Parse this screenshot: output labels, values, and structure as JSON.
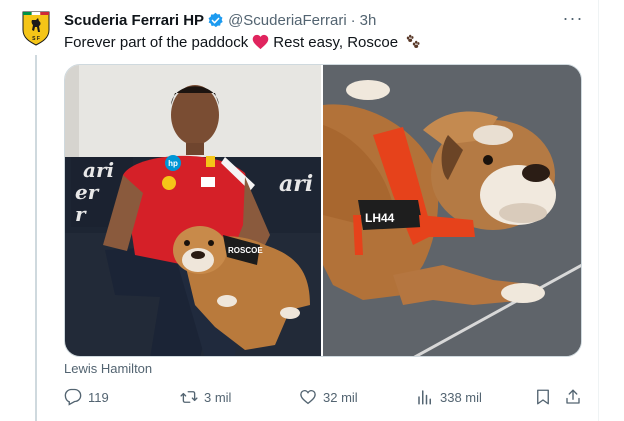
{
  "tweet": {
    "display_name": "Scuderia Ferrari HP",
    "handle": "@ScuderiaFerrari",
    "separator": "·",
    "time": "3h",
    "more_label": "···",
    "text_part1": "Forever part of the paddock",
    "text_part2": "Rest easy, Roscoe",
    "media_credit": "Lewis Hamilton",
    "photo_left_labels": {
      "shirt_brand": "hp",
      "bandana": "ROSCOE",
      "backdrop": "ari"
    },
    "photo_right_labels": {
      "harness": "LH44"
    }
  },
  "actions": {
    "replies": "119",
    "reposts": "3 mil",
    "likes": "32 mil",
    "views": "338 mil"
  },
  "colors": {
    "verified": "#1d9bf0",
    "heart": "#e0245e",
    "ferrari_red": "#d61f26",
    "ferrari_yellow": "#f5c518",
    "muted": "#536471"
  },
  "icons": [
    "ferrari-logo-icon",
    "verified-badge-icon",
    "more-icon",
    "heart-emoji-icon",
    "paw-prints-icon",
    "reply-icon",
    "repost-icon",
    "like-icon",
    "views-icon",
    "bookmark-icon",
    "share-icon"
  ]
}
